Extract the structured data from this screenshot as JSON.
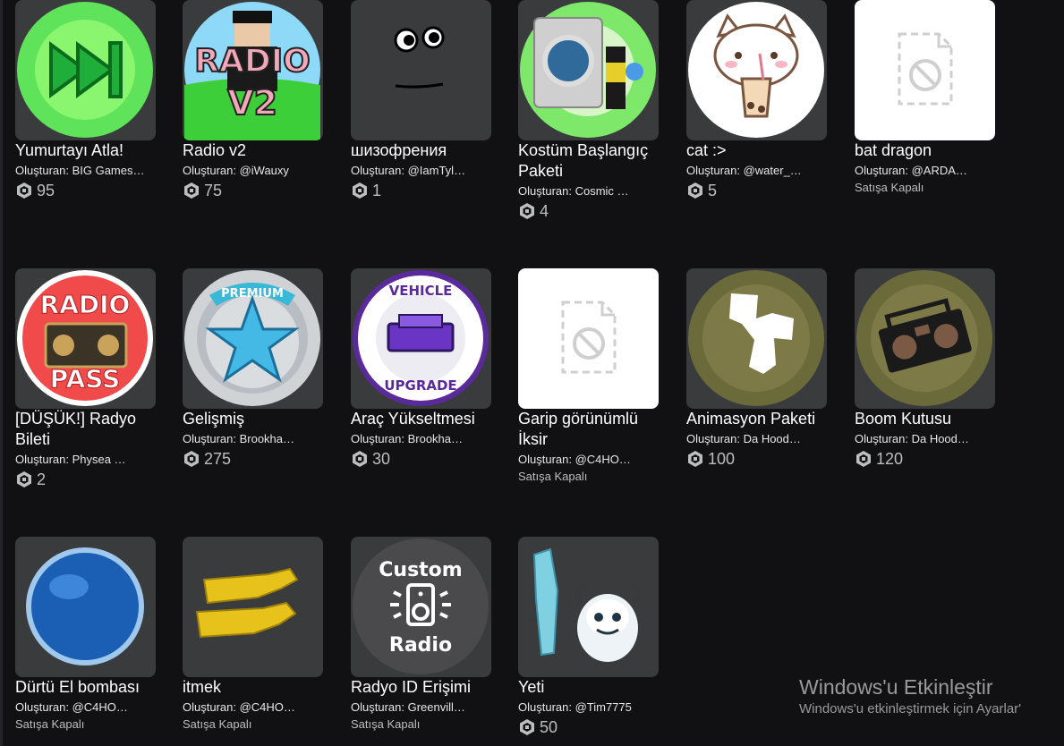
{
  "icons": {
    "currency": "robux-icon"
  },
  "items": [
    {
      "name": "Yumurtayı Atla!",
      "creator": "Oluşturan: BIG Games…",
      "price": "95",
      "offsale": ""
    },
    {
      "name": "Radio v2",
      "creator": "Oluşturan: @iWauxy",
      "price": "75",
      "offsale": ""
    },
    {
      "name": "шизофрения",
      "creator": "Oluşturan: @IamTyl…",
      "price": "1",
      "offsale": ""
    },
    {
      "name": "Kostüm Başlangıç Paketi",
      "creator": "Oluşturan: Cosmic …",
      "price": "4",
      "offsale": ""
    },
    {
      "name": "cat :>",
      "creator": "Oluşturan: @water_…",
      "price": "5",
      "offsale": ""
    },
    {
      "name": "bat dragon",
      "creator": "Oluşturan: @ARDA…",
      "price": "",
      "offsale": "Satışa Kapalı"
    },
    {
      "name": "[DÜŞÜK!] Radyo Bileti",
      "creator": "Oluşturan: Physea …",
      "price": "2",
      "offsale": ""
    },
    {
      "name": "Gelişmiş",
      "creator": "Oluşturan: Brookha…",
      "price": "275",
      "offsale": ""
    },
    {
      "name": "Araç Yükseltmesi",
      "creator": "Oluşturan: Brookha…",
      "price": "30",
      "offsale": ""
    },
    {
      "name": "Garip görünümlü İksir",
      "creator": "Oluşturan: @C4HO…",
      "price": "",
      "offsale": "Satışa Kapalı"
    },
    {
      "name": "Animasyon Paketi",
      "creator": "Oluşturan: Da Hood…",
      "price": "100",
      "offsale": ""
    },
    {
      "name": "Boom Kutusu",
      "creator": "Oluşturan: Da Hood…",
      "price": "120",
      "offsale": ""
    },
    {
      "name": "Dürtü El bombası",
      "creator": "Oluşturan: @C4HO…",
      "price": "",
      "offsale": "Satışa Kapalı"
    },
    {
      "name": "itmek",
      "creator": "Oluşturan: @C4HO…",
      "price": "",
      "offsale": "Satışa Kapalı"
    },
    {
      "name": "Radyo ID Erişimi",
      "creator": "Oluşturan: Greenvill…",
      "price": "",
      "offsale": "Satışa Kapalı"
    },
    {
      "name": "Yeti",
      "creator": "Oluşturan: @Tim7775",
      "price": "50",
      "offsale": ""
    }
  ],
  "thumb_text": {
    "radio_v2": [
      "RADIO",
      "V2"
    ],
    "radio_pass": [
      "RADIO",
      "PASS"
    ],
    "premium": "PREMIUM",
    "vehicle": [
      "VEHICLE",
      "UPGRADE"
    ],
    "custom_radio": [
      "Custom",
      "Radio"
    ]
  },
  "windows_activation": {
    "title": "Windows'u Etkinleştir",
    "subtitle": "Windows'u etkinleştirmek için Ayarlar'"
  }
}
